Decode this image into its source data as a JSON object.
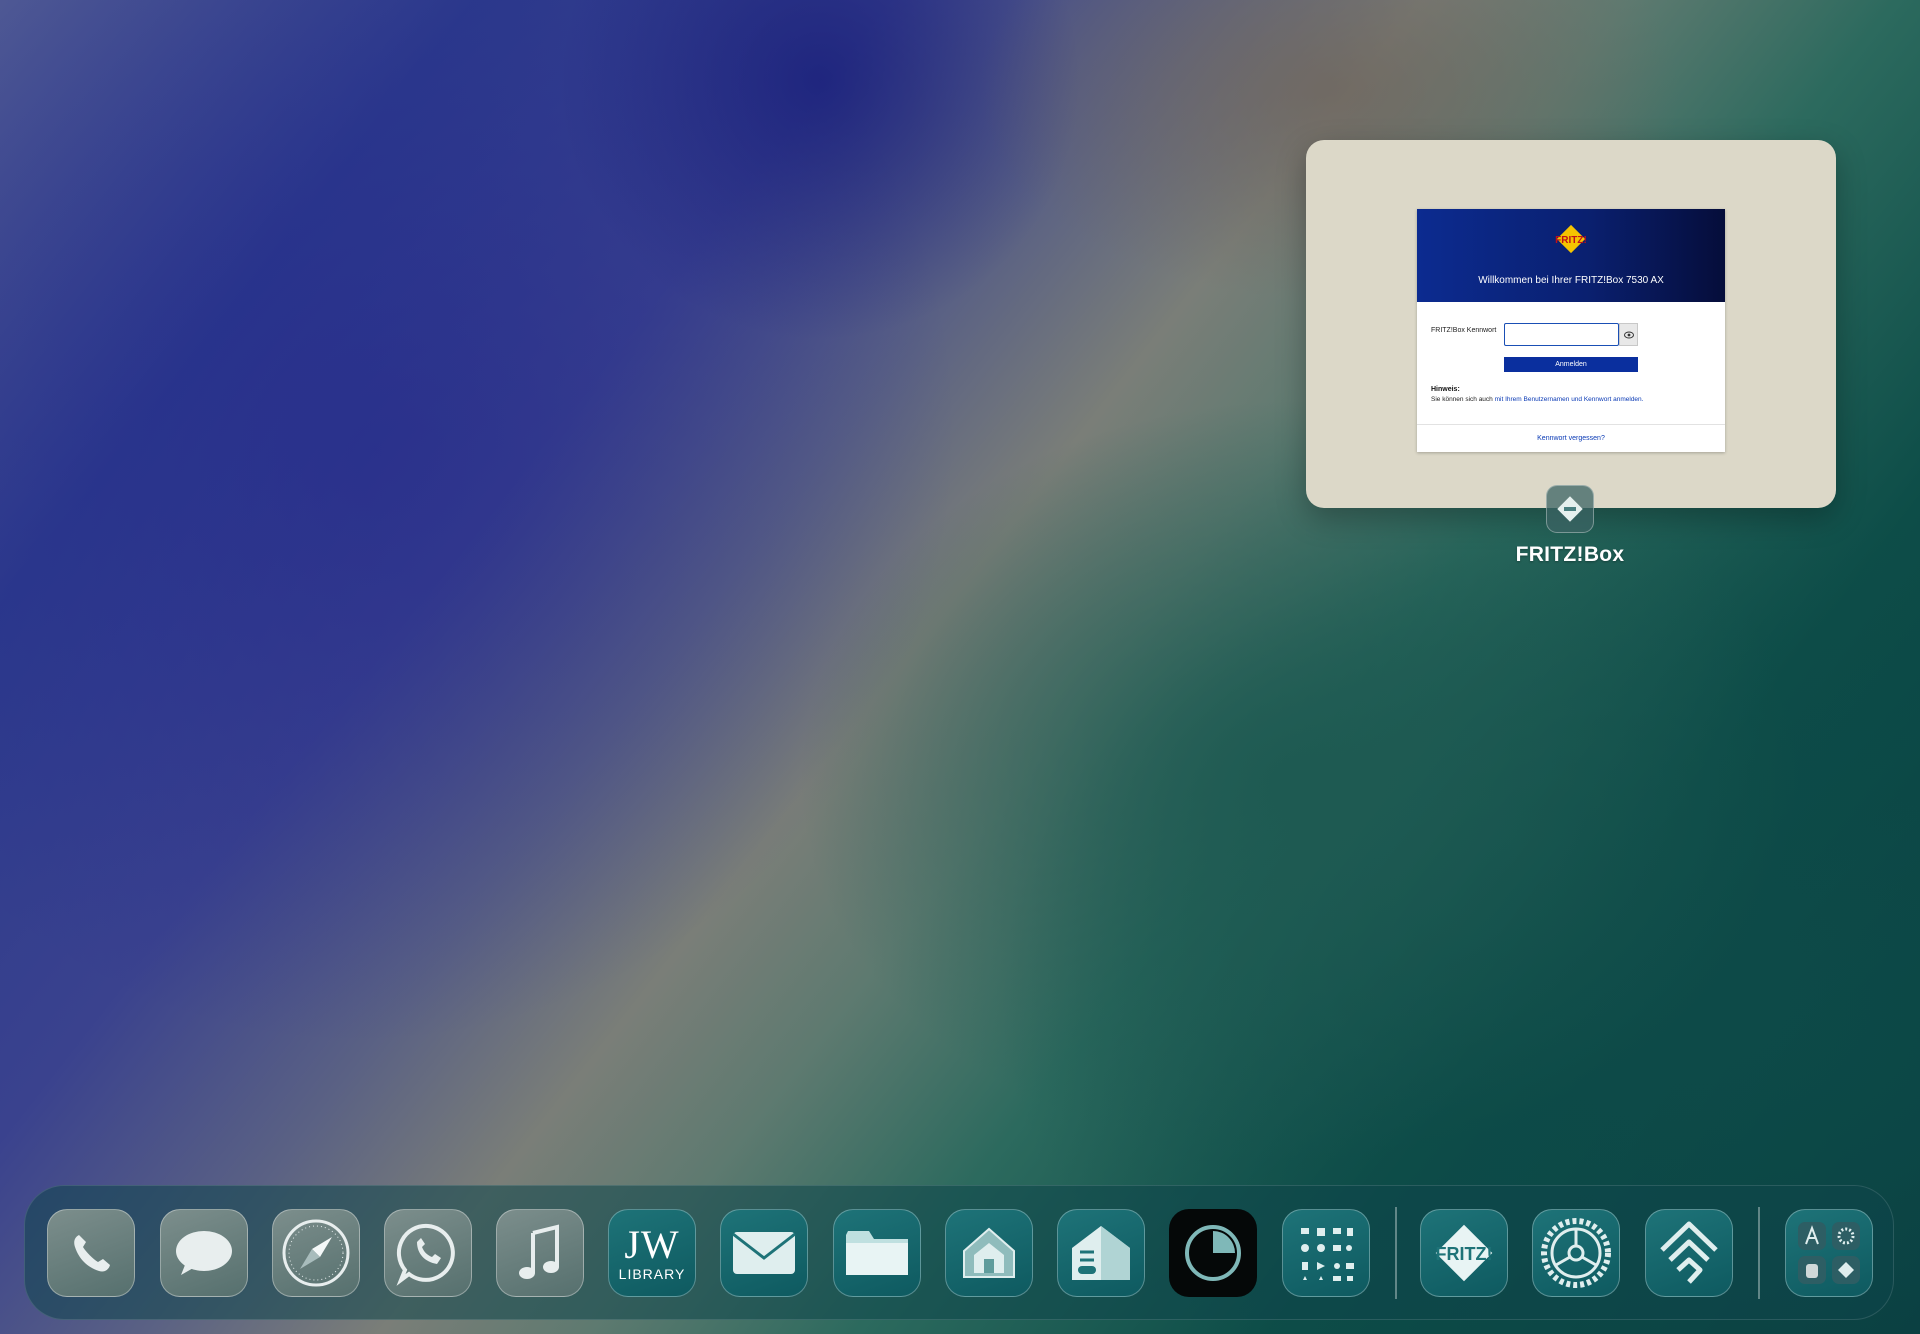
{
  "app_switcher": {
    "app_name": "FRITZ!Box",
    "login": {
      "logo_text": "FRITZ!",
      "welcome": "Willkommen bei Ihrer FRITZ!Box 7530 AX",
      "password_label": "FRITZ!Box Kennwort",
      "password_value": "",
      "login_button": "Anmelden",
      "hint_title": "Hinweis:",
      "hint_text_prefix": "Sie können sich auch ",
      "hint_link": "mit Ihrem Benutzernamen und Kennwort anmelden.",
      "forgot_link": "Kennwort vergessen?"
    }
  },
  "dock": {
    "apps": [
      {
        "name": "Phone",
        "icon": "phone-icon"
      },
      {
        "name": "Messages",
        "icon": "messages-icon"
      },
      {
        "name": "Safari",
        "icon": "compass-icon"
      },
      {
        "name": "WhatsApp",
        "icon": "whatsapp-icon"
      },
      {
        "name": "Music",
        "icon": "music-note-icon"
      },
      {
        "name": "JW Library",
        "icon": "jw-library-icon",
        "label_top": "JW",
        "label_bottom": "LIBRARY"
      },
      {
        "name": "Mail",
        "icon": "envelope-icon"
      },
      {
        "name": "Files",
        "icon": "folder-icon"
      },
      {
        "name": "Home",
        "icon": "house-icon"
      },
      {
        "name": "Home Settings",
        "icon": "house-settings-icon"
      },
      {
        "name": "Screen Time",
        "icon": "pie-timer-icon"
      },
      {
        "name": "Widgets",
        "icon": "icon-grid-icon"
      },
      {
        "name": "FRITZ!App",
        "icon": "fritz-icon",
        "label": "FRITZ!"
      },
      {
        "name": "Settings",
        "icon": "gear-icon"
      },
      {
        "name": "Home Assistant",
        "icon": "home-assistant-icon"
      },
      {
        "name": "App Library",
        "icon": "app-library-icon"
      }
    ]
  },
  "colors": {
    "fritz_blue": "#0a2f9e",
    "card_bg": "#dcd8c8",
    "dock_teal": "#1e7378"
  }
}
